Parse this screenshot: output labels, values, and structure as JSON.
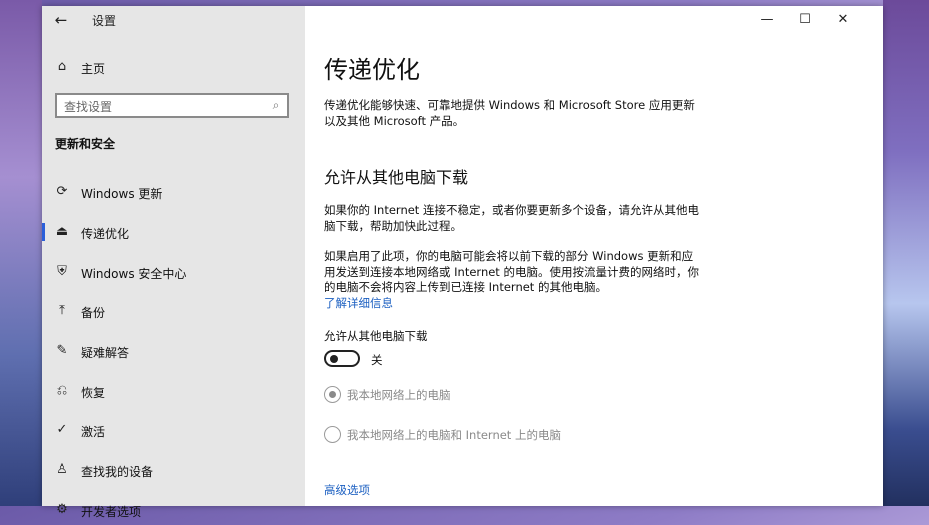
{
  "window": {
    "app_title": "设置",
    "controls": {
      "minimize": "—",
      "maximize": "☐",
      "close": "✕"
    }
  },
  "sidebar": {
    "home_label": "主页",
    "search_placeholder": "查找设置",
    "section_title": "更新和安全",
    "items": [
      {
        "label": "Windows 更新",
        "icon": "sync-icon"
      },
      {
        "label": "传递优化",
        "icon": "delivery-icon",
        "active": true
      },
      {
        "label": "Windows 安全中心",
        "icon": "shield-icon"
      },
      {
        "label": "备份",
        "icon": "backup-arrow-icon"
      },
      {
        "label": "疑难解答",
        "icon": "wrench-icon"
      },
      {
        "label": "恢复",
        "icon": "recovery-icon"
      },
      {
        "label": "激活",
        "icon": "check-circle-icon"
      },
      {
        "label": "查找我的设备",
        "icon": "person-locate-icon"
      },
      {
        "label": "开发者选项",
        "icon": "dev-tools-icon"
      }
    ]
  },
  "main": {
    "title": "传递优化",
    "intro": "传递优化能够快速、可靠地提供 Windows 和 Microsoft Store 应用更新以及其他 Microsoft 产品。",
    "section_title": "允许从其他电脑下载",
    "para1": "如果你的 Internet 连接不稳定，或者你要更新多个设备，请允许从其他电脑下载，帮助加快此过程。",
    "para2": "如果启用了此项，你的电脑可能会将以前下载的部分 Windows 更新和应用发送到连接本地网络或 Internet 的电脑。使用按流量计费的网络时，你的电脑不会将内容上传到已连接 Internet 的其他电脑。",
    "learn_more": "了解详细信息",
    "toggle_label": "允许从其他电脑下载",
    "toggle_state": "关",
    "toggle_on": false,
    "radio_local": "我本地网络上的电脑",
    "radio_internet": "我本地网络上的电脑和 Internet 上的电脑",
    "advanced_link": "高级选项"
  }
}
